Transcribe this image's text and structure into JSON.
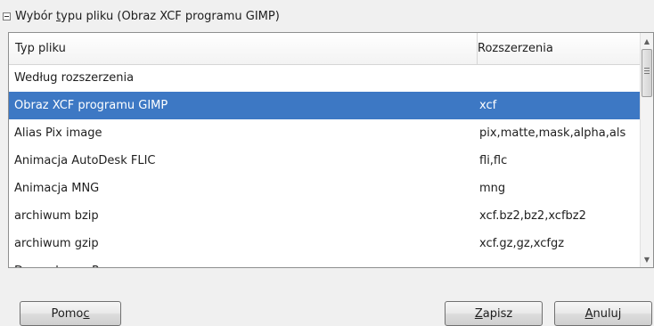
{
  "section": {
    "label_before": "Wybór ",
    "label_access": "t",
    "label_after": "ypu pliku (Obraz XCF programu GIMP)"
  },
  "table": {
    "columns": [
      "Typ pliku",
      "Rozszerzenia"
    ],
    "rows": [
      {
        "type": "Według rozszerzenia",
        "extensions": ""
      },
      {
        "type": "Obraz XCF programu GIMP",
        "extensions": "xcf",
        "selected": true
      },
      {
        "type": "Alias Pix image",
        "extensions": "pix,matte,mask,alpha,als"
      },
      {
        "type": "Animacja AutoDesk FLIC",
        "extensions": "fli,flc"
      },
      {
        "type": "Animacja MNG",
        "extensions": "mng"
      },
      {
        "type": "archiwum bzip",
        "extensions": "xcf.bz2,bz2,xcfbz2"
      },
      {
        "type": "archiwum gzip",
        "extensions": "xcf.gz,gz,xcfgz"
      },
      {
        "type": "Dane obrazu R",
        "extensions": ""
      }
    ]
  },
  "buttons": {
    "help": {
      "before": "Pomo",
      "access": "c",
      "after": ""
    },
    "save": {
      "before": "",
      "access": "Z",
      "after": "apisz"
    },
    "cancel": {
      "before": "",
      "access": "A",
      "after": "nuluj"
    }
  },
  "colors": {
    "selection": "#3d78c4"
  }
}
